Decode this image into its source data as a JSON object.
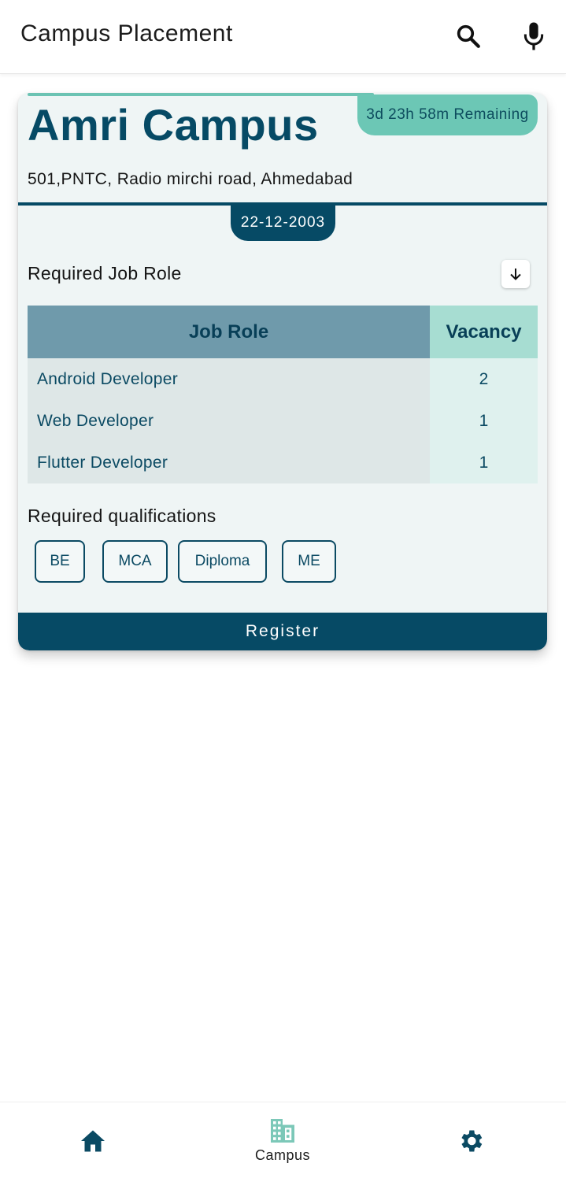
{
  "appbar": {
    "title": "Campus Placement",
    "search_icon": "search-icon",
    "mic_icon": "mic-icon"
  },
  "card": {
    "campus_name": "Amri Campus",
    "remaining": "3d 23h 58m Remaining",
    "address": "501,PNTC, Radio mirchi road, Ahmedabad",
    "date": "22-12-2003",
    "job_role_section": "Required Job Role",
    "expand_icon": "arrow-down-icon",
    "table": {
      "headers": [
        "Job Role",
        "Vacancy"
      ],
      "rows": [
        {
          "role": "Android Developer",
          "vacancy": "2"
        },
        {
          "role": "Web Developer",
          "vacancy": "1"
        },
        {
          "role": "Flutter Developer",
          "vacancy": "1"
        }
      ]
    },
    "qualifications_section": "Required qualifications",
    "qualifications": [
      "BE",
      "MCA",
      "Diploma",
      "ME"
    ],
    "register_label": "Register"
  },
  "bottom_nav": {
    "items": [
      {
        "icon": "home-icon",
        "label": ""
      },
      {
        "icon": "building-icon",
        "label": "Campus"
      },
      {
        "icon": "gear-icon",
        "label": ""
      }
    ]
  },
  "colors": {
    "primary": "#064a65",
    "accent": "#6cc7b5",
    "card_bg": "#eff5f5"
  }
}
